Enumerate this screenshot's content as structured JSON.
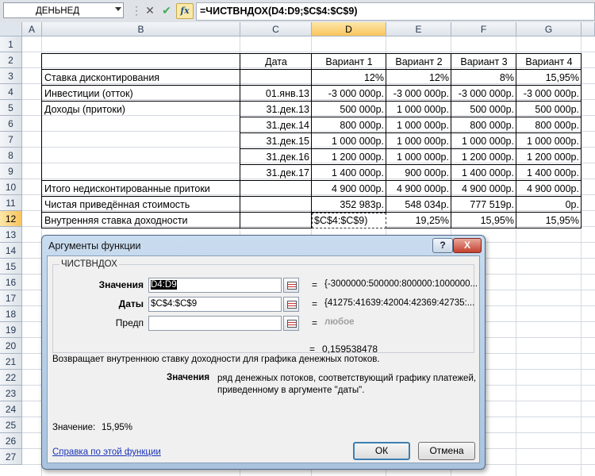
{
  "formula_bar": {
    "name_box": "ДЕНЬНЕД",
    "cancel_glyph": "✕",
    "enter_glyph": "✔",
    "fx_label": "fx",
    "formula": "=ЧИСТВНДОХ(D4:D9;$C$4:$C$9)"
  },
  "columns": [
    "A",
    "B",
    "C",
    "D",
    "E",
    "F",
    "G"
  ],
  "rows": [
    "1",
    "2",
    "3",
    "4",
    "5",
    "6",
    "7",
    "8",
    "9",
    "10",
    "11",
    "12",
    "13",
    "14",
    "15",
    "16",
    "17",
    "18",
    "19",
    "20",
    "21",
    "22",
    "23",
    "24",
    "25",
    "26",
    "27"
  ],
  "table": {
    "header": {
      "date": "Дата",
      "v1": "Вариант 1",
      "v2": "Вариант 2",
      "v3": "Вариант 3",
      "v4": "Вариант 4"
    },
    "r3": {
      "label": "Ставка дисконтирования",
      "d": "12%",
      "e": "12%",
      "f": "8%",
      "g": "15,95%"
    },
    "r4": {
      "label": "Инвестиции (отток)",
      "date": "01.янв.13",
      "d": "-3 000 000р.",
      "e": "-3 000 000р.",
      "f": "-3 000 000р.",
      "g": "-3 000 000р."
    },
    "r5": {
      "label": "Доходы (притоки)",
      "date": "31.дек.13",
      "d": "500 000р.",
      "e": "1 000 000р.",
      "f": "500 000р.",
      "g": "500 000р."
    },
    "r6": {
      "date": "31.дек.14",
      "d": "800 000р.",
      "e": "1 000 000р.",
      "f": "800 000р.",
      "g": "800 000р."
    },
    "r7": {
      "date": "31.дек.15",
      "d": "1 000 000р.",
      "e": "1 000 000р.",
      "f": "1 000 000р.",
      "g": "1 000 000р."
    },
    "r8": {
      "date": "31.дек.16",
      "d": "1 200 000р.",
      "e": "1 000 000р.",
      "f": "1 200 000р.",
      "g": "1 200 000р."
    },
    "r9": {
      "date": "31.дек.17",
      "d": "1 400 000р.",
      "e": "900 000р.",
      "f": "1 400 000р.",
      "g": "1 400 000р."
    },
    "r10": {
      "label": "Итого недисконтированные притоки",
      "d": "4 900 000р.",
      "e": "4 900 000р.",
      "f": "4 900 000р.",
      "g": "4 900 000р."
    },
    "r11": {
      "label": "Чистая приведённая стоимость",
      "d": "352 983р.",
      "e": "548 034р.",
      "f": "777 519р.",
      "g": "0р."
    },
    "r12": {
      "label": "Внутренняя ставка доходности",
      "d": "$C$4:$C$9)",
      "e": "19,25%",
      "f": "15,95%",
      "g": "15,95%"
    }
  },
  "dialog": {
    "title": "Аргументы функции",
    "help_glyph": "?",
    "close_glyph": "X",
    "function_name": "ЧИСТВНДОХ",
    "args": [
      {
        "label": "Значения",
        "value": "D4:D9",
        "eq": "=",
        "result": "{-3000000:500000:800000:1000000..."
      },
      {
        "label": "Даты",
        "value": "$C$4:$C$9",
        "eq": "=",
        "result": "{41275:41639:42004:42369:42735:..."
      },
      {
        "label": "Предп",
        "value": "",
        "eq": "=",
        "result": "любое"
      }
    ],
    "result_eq": "=",
    "result": "0,159538478",
    "description": "Возвращает внутреннюю ставку доходности для графика денежных потоков.",
    "arg_desc_name": "Значения",
    "arg_desc_text": "ряд денежных потоков, соответствующий графику платежей, приведенному в аргументе \"даты\".",
    "value_label": "Значение:",
    "value": "15,95%",
    "help_link": "Справка по этой функции",
    "ok": "ОК",
    "cancel": "Отмена"
  }
}
